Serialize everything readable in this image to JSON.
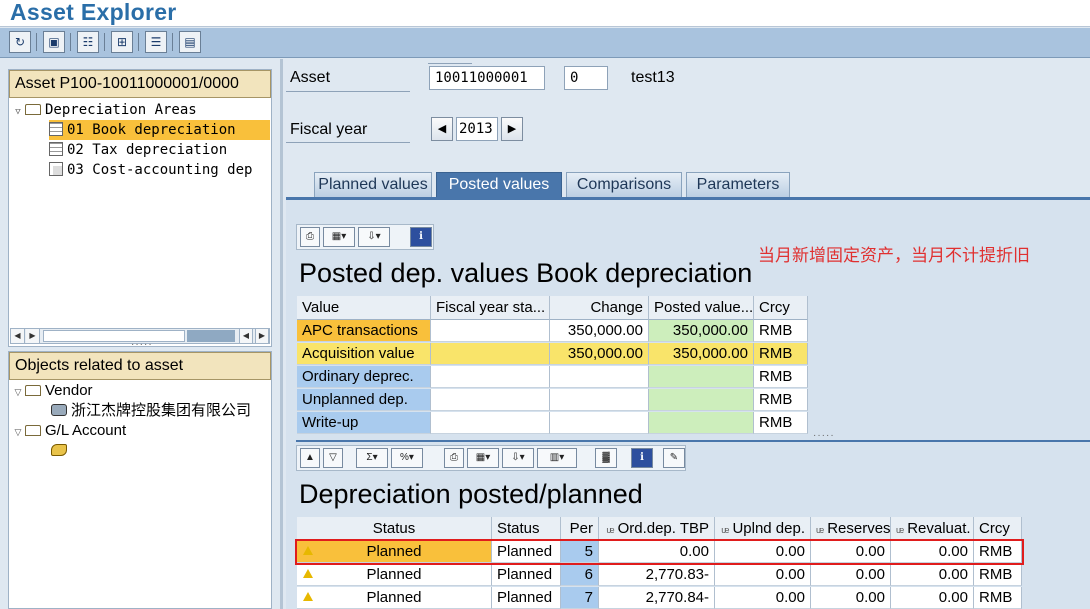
{
  "window": {
    "title": "Asset Explorer"
  },
  "toolbar": {
    "icons": [
      "refresh-icon",
      "switch-icon",
      "asset-values-icon",
      "structure-icon",
      "cost-center-icon",
      "display-icon"
    ]
  },
  "left": {
    "asset_header": "Asset P100-10011000001/0000",
    "areas_node": "Depreciation Areas",
    "areas": [
      {
        "label": "01 Book depreciation",
        "selected": true
      },
      {
        "label": "02 Tax depreciation",
        "selected": false
      },
      {
        "label": "03 Cost-accounting dep",
        "selected": false
      }
    ],
    "objects_header": "Objects related to asset",
    "vendor_node": "Vendor",
    "vendor_name": "浙江杰牌控股集团有限公司",
    "gl_node": "G/L Account"
  },
  "header": {
    "asset_label": "Asset",
    "asset_number": "10011000001",
    "asset_sub": "0",
    "asset_desc": "test13",
    "fiscal_year_label": "Fiscal year",
    "fiscal_year": "2013"
  },
  "tabs": [
    "Planned values",
    "Posted values",
    "Comparisons",
    "Parameters"
  ],
  "active_tab": "Posted values",
  "annotation": "当月新增固定资产，当月不计提折旧",
  "posted": {
    "title": "Posted dep. values Book depreciation",
    "columns": [
      "Value",
      "Fiscal year sta...",
      "Change",
      "Posted value...",
      "Crcy"
    ],
    "rows": [
      [
        "APC transactions",
        "",
        "350,000.00",
        "350,000.00",
        "RMB"
      ],
      [
        "Acquisition value",
        "",
        "350,000.00",
        "350,000.00",
        "RMB"
      ],
      [
        "Ordinary deprec.",
        "",
        "",
        "",
        "RMB"
      ],
      [
        "Unplanned dep.",
        "",
        "",
        "",
        "RMB"
      ],
      [
        "Write-up",
        "",
        "",
        "",
        "RMB"
      ]
    ]
  },
  "planned": {
    "title": "Depreciation posted/planned",
    "columns": [
      "Status",
      "Status",
      "Per",
      "Ord.dep. TBP",
      "Uplnd dep.",
      "Reserves",
      "Revaluat.",
      "Crcy"
    ],
    "rows": [
      [
        "Planned",
        "Planned",
        "5",
        "0.00",
        "0.00",
        "0.00",
        "0.00",
        "RMB"
      ],
      [
        "Planned",
        "Planned",
        "6",
        "2,770.83-",
        "0.00",
        "0.00",
        "0.00",
        "RMB"
      ],
      [
        "Planned",
        "Planned",
        "7",
        "2,770.84-",
        "0.00",
        "0.00",
        "0.00",
        "RMB"
      ]
    ]
  },
  "colors": {
    "selection": "#f9c03b",
    "highlight": "#e01c1c",
    "annotation": "#e03030",
    "tab_active": "#4976ab"
  }
}
